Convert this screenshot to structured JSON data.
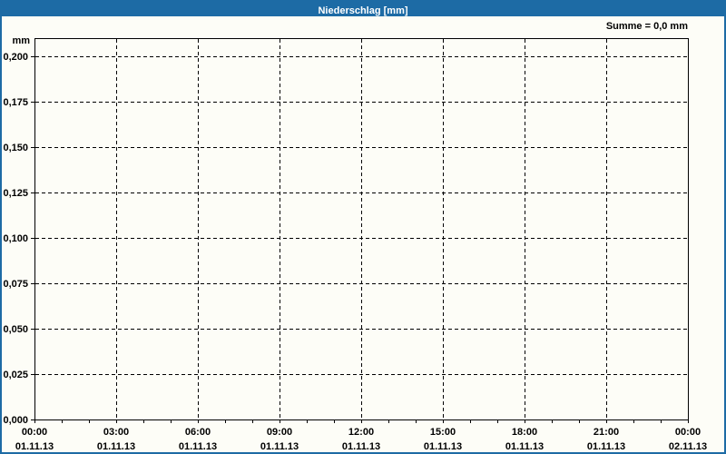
{
  "window": {
    "title": "Niederschlag [mm]"
  },
  "chart_data": {
    "type": "bar",
    "title": "Niederschlag [mm]",
    "annotation": "Summe = 0,0 mm",
    "grid": "dashed",
    "legend": "none",
    "y_axis": {
      "unit_label": "mm",
      "tick_labels": [
        "0,200",
        "0,175",
        "0,150",
        "0,125",
        "0,100",
        "0,075",
        "0,050",
        "0,025",
        "0,000"
      ],
      "tick_values": [
        0.2,
        0.175,
        0.15,
        0.125,
        0.1,
        0.075,
        0.05,
        0.025,
        0.0
      ],
      "min": 0.0,
      "max": 0.21
    },
    "x_axis": {
      "total_hours": 24,
      "major_tick_interval_hours": 3,
      "minor_tick_interval_hours": 1,
      "major_ticks": [
        {
          "time": "00:00",
          "date": "01.11.13"
        },
        {
          "time": "03:00",
          "date": "01.11.13"
        },
        {
          "time": "06:00",
          "date": "01.11.13"
        },
        {
          "time": "09:00",
          "date": "01.11.13"
        },
        {
          "time": "12:00",
          "date": "01.11.13"
        },
        {
          "time": "15:00",
          "date": "01.11.13"
        },
        {
          "time": "18:00",
          "date": "01.11.13"
        },
        {
          "time": "21:00",
          "date": "01.11.13"
        },
        {
          "time": "00:00",
          "date": "02.11.13"
        }
      ]
    },
    "series": [
      {
        "name": "Niederschlag",
        "values": []
      }
    ]
  },
  "colors": {
    "accent_blue": "#1d6ba5",
    "title_text": "#ffffff",
    "background": "#fdfdf7",
    "axis_and_text": "#000000"
  }
}
